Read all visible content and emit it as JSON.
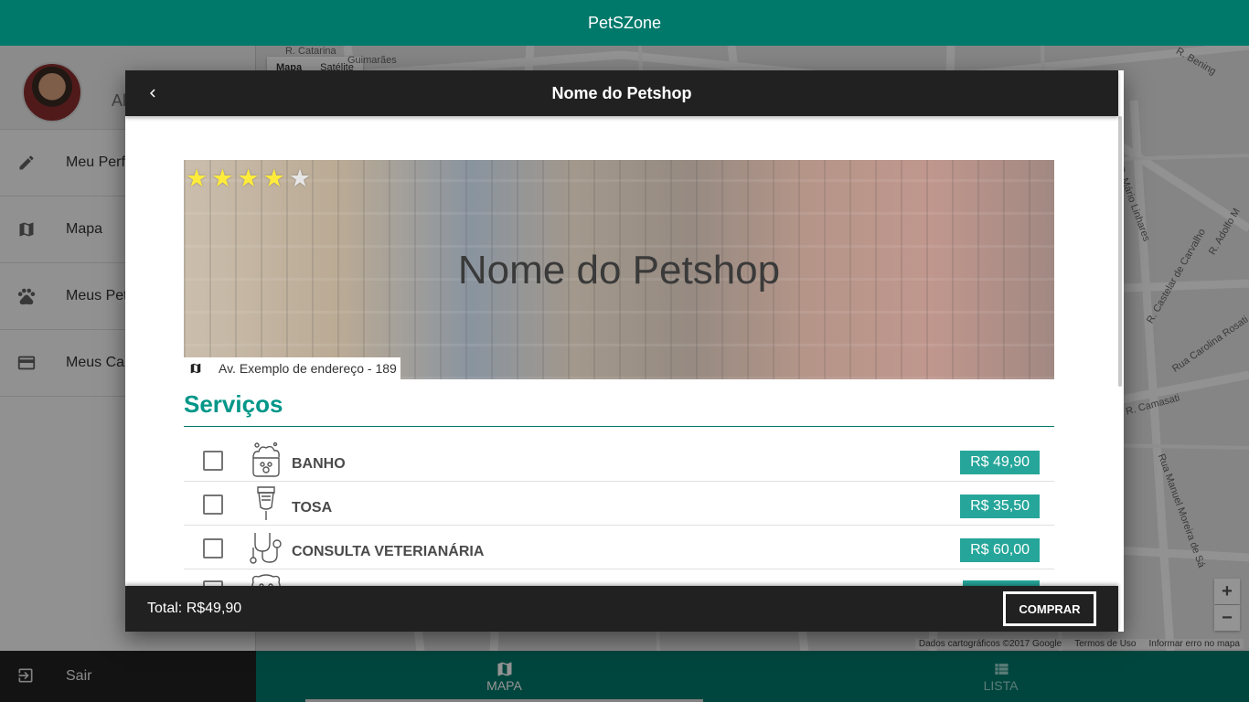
{
  "app": {
    "title": "PetSZone"
  },
  "drawer": {
    "user_name": "Al",
    "items": [
      {
        "label": "Meu Perfi",
        "icon": "pencil-icon"
      },
      {
        "label": "Mapa",
        "icon": "map-icon"
      },
      {
        "label": "Meus Pet",
        "icon": "paw-icon"
      },
      {
        "label": "Meus Car",
        "icon": "credit-card-icon"
      }
    ],
    "logout": {
      "label": "Sair",
      "icon": "exit-icon"
    }
  },
  "map": {
    "type_options": [
      "Mapa",
      "Satélite"
    ],
    "selected_type": "Mapa",
    "streets": [
      "R. Catarina",
      "Guimarães",
      "R. Mário Linhares",
      "R. Castelar de Carvalho",
      "R. Adolfo M",
      "Rua Carolina Rosati",
      "R. Camasati",
      "Rua Manuel Moreira de Sá",
      "R. Bening"
    ],
    "zoom_in": "+",
    "zoom_out": "−",
    "footer": [
      "Dados cartográficos ©2017 Google",
      "Termos de Uso",
      "Informar erro no mapa"
    ]
  },
  "bottom_nav": {
    "tabs": [
      {
        "label": "MAPA",
        "icon": "map-icon",
        "active": true
      },
      {
        "label": "LISTA",
        "icon": "list-icon",
        "active": false
      }
    ]
  },
  "dialog": {
    "title": "Nome do Petshop",
    "hero_title": "Nome do Petshop",
    "rating": 4,
    "rating_max": 5,
    "address": "Av. Exemplo de endereço - 189",
    "services_heading": "Serviços",
    "services": [
      {
        "name": "BANHO",
        "price": "R$ 49,90",
        "icon": "bath-icon"
      },
      {
        "name": "TOSA",
        "price": "R$ 35,50",
        "icon": "clipper-icon"
      },
      {
        "name": "CONSULTA VETERIANÁRIA",
        "price": "R$ 60,00",
        "icon": "stethoscope-icon"
      }
    ],
    "total": "Total: R$49,90",
    "buy_label": "COMPRAR"
  },
  "colors": {
    "primary": "#00796b",
    "accent": "#009688",
    "price_badge": "#26a69a",
    "dark": "#212121",
    "star": "#ffeb3b"
  }
}
